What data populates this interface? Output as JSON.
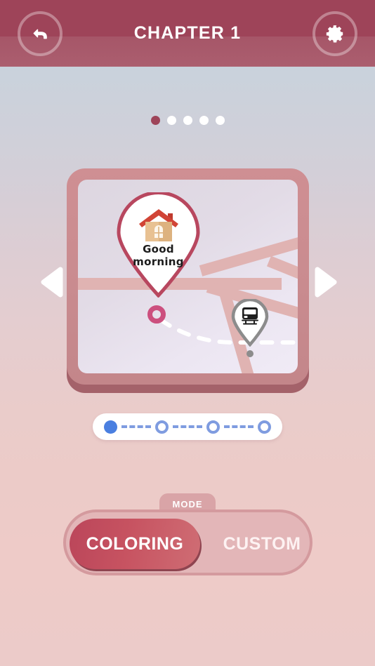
{
  "header": {
    "title": "CHAPTER 1",
    "back_icon": "back-arrow-icon",
    "settings_icon": "gear-icon",
    "bg_color": "#9e4459"
  },
  "pagination": {
    "total": 5,
    "active_index": 0,
    "active_color": "#9e4459",
    "inactive_color": "#ffffff"
  },
  "carousel": {
    "prev_label": "previous-slide",
    "next_label": "next-slide",
    "card": {
      "frame_color": "#c98b8f",
      "map": {
        "home_pin": {
          "icon": "house-icon",
          "label_line1": "Good",
          "label_line2": "morning",
          "border_color": "#b8475f"
        },
        "ring_marker": {
          "color": "#cc4f7e"
        },
        "station_pin": {
          "icon": "train-icon",
          "border_color": "#8c8c8c"
        },
        "route": {
          "style": "dashed",
          "color": "#ffffff"
        },
        "road_color": "#e0b3b2"
      }
    }
  },
  "progress": {
    "steps": [
      {
        "state": "done"
      },
      {
        "state": "todo"
      },
      {
        "state": "todo"
      },
      {
        "state": "todo"
      }
    ],
    "done_color": "#4a7fe0",
    "todo_color": "#7f9ce0"
  },
  "mode": {
    "tab_label": "MODE",
    "options": [
      {
        "label": "COLORING",
        "selected": true
      },
      {
        "label": "CUSTOM",
        "selected": false
      }
    ],
    "selected_color": "#c75361"
  }
}
